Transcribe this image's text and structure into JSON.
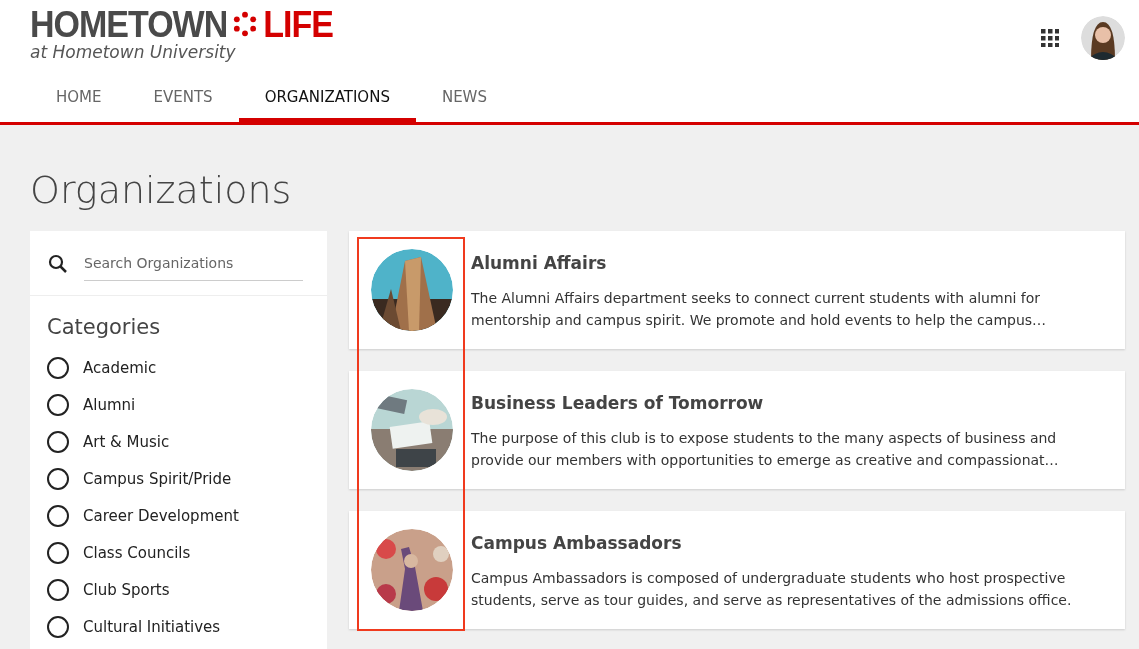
{
  "logo": {
    "word_left": "HOMETOWN",
    "word_right": "LIFE",
    "subtitle": "at Hometown University"
  },
  "nav": [
    {
      "label": "HOME",
      "selected": false
    },
    {
      "label": "EVENTS",
      "selected": false
    },
    {
      "label": "ORGANIZATIONS",
      "selected": true
    },
    {
      "label": "NEWS",
      "selected": false
    }
  ],
  "page_title": "Organizations",
  "search": {
    "placeholder": "Search Organizations"
  },
  "categories_title": "Categories",
  "categories": [
    {
      "label": "Academic",
      "selected": false
    },
    {
      "label": "Alumni",
      "selected": false
    },
    {
      "label": "Art & Music",
      "selected": false
    },
    {
      "label": "Campus Spirit/Pride",
      "selected": false
    },
    {
      "label": "Career Development",
      "selected": false
    },
    {
      "label": "Class Councils",
      "selected": false
    },
    {
      "label": "Club Sports",
      "selected": false
    },
    {
      "label": "Cultural Initiatives",
      "selected": false
    }
  ],
  "organizations": [
    {
      "name": "Alumni Affairs",
      "description": "The Alumni Affairs department seeks to connect current students with alumni for mentorship and campus spirit. We promote and hold events to help the campus…",
      "kind": "picture"
    },
    {
      "name": "Business Leaders of Tomorrow",
      "description": "The purpose of this club is to expose students to the many aspects of business and provide our members with opportunities to emerge as creative and compassionat…",
      "kind": "picture"
    },
    {
      "name": "Campus Ambassadors",
      "description": "Campus Ambassadors is composed of undergraduate students who host prospective students, serve as tour guides, and serve as representatives of the admissions office.",
      "kind": "picture"
    }
  ]
}
